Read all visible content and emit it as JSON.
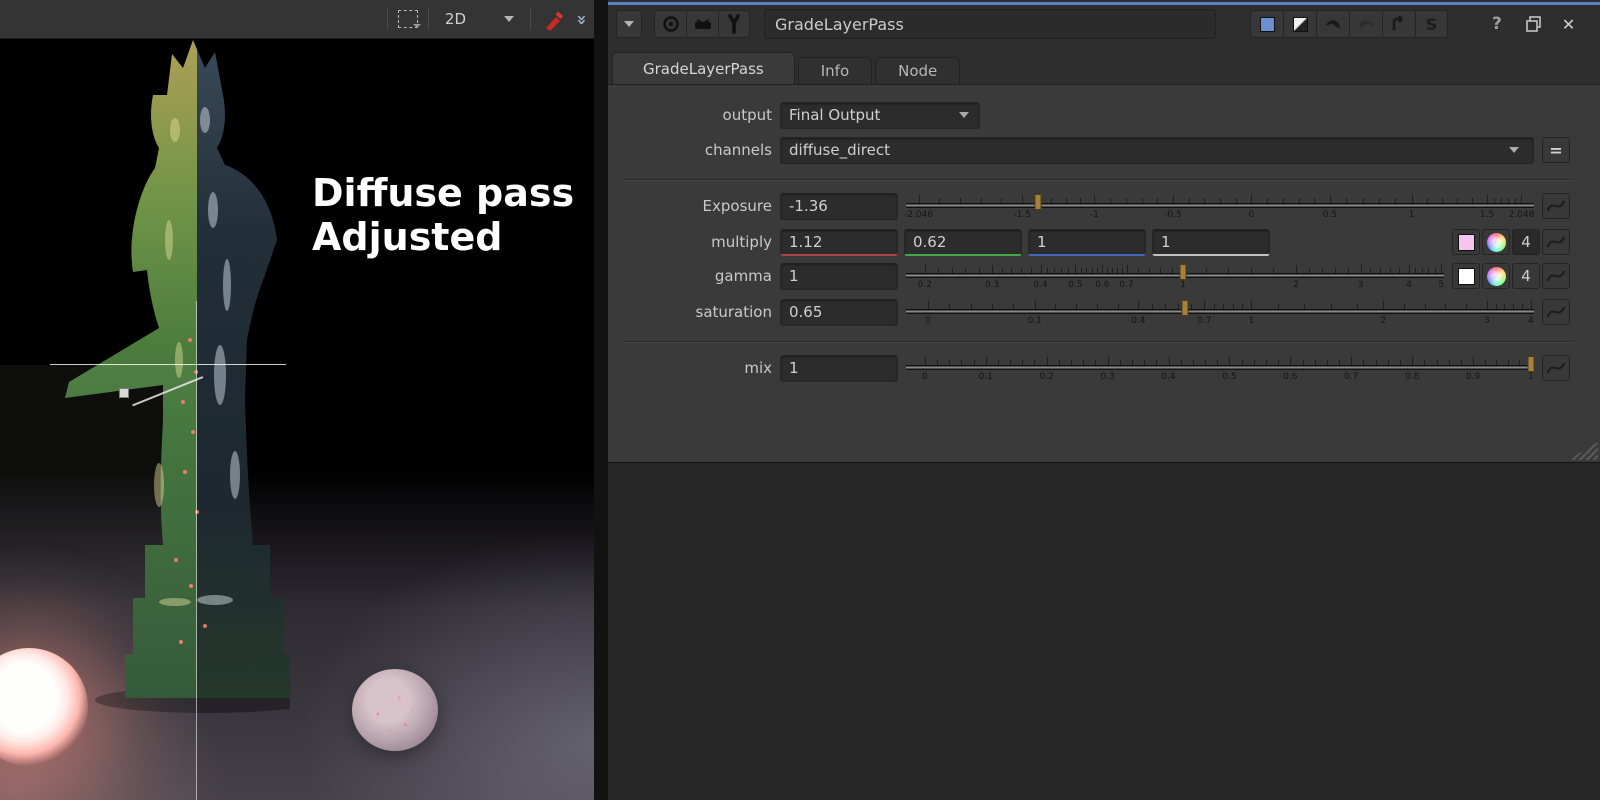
{
  "viewer": {
    "toolbar": {
      "view_mode": "2D"
    },
    "overlay": {
      "line1": "Diffuse pass",
      "line2": "Adjusted"
    }
  },
  "panel": {
    "header": {
      "node_name": "GradeLayerPass",
      "s_label": "S",
      "help_label": "?",
      "close_label": "✕"
    },
    "tabs": [
      {
        "label": "GradeLayerPass",
        "active": true
      },
      {
        "label": "Info",
        "active": false
      },
      {
        "label": "Node",
        "active": false
      }
    ],
    "rows": {
      "output": {
        "label": "output",
        "value": "Final Output"
      },
      "channels": {
        "label": "channels",
        "value": "diffuse_direct",
        "equals_label": "="
      },
      "exposure": {
        "label": "Exposure",
        "value": "-1.36",
        "slider": {
          "handle_p": 21,
          "labels": [
            {
              "t": "-2.046",
              "p": 2
            },
            {
              "t": "-1.5",
              "p": 18.5
            },
            {
              "t": "-1",
              "p": 30
            },
            {
              "t": "-0.5",
              "p": 42.5
            },
            {
              "t": "0",
              "p": 55
            },
            {
              "t": "0.5",
              "p": 67.5
            },
            {
              "t": "1",
              "p": 80.5
            },
            {
              "t": "1.5",
              "p": 92.5
            },
            {
              "t": "2.048",
              "p": 98
            }
          ]
        }
      },
      "multiply": {
        "label": "multiply",
        "values": [
          "1.12",
          "0.62",
          "1",
          "1"
        ],
        "count_label": "4",
        "swatch_color": "#f6c4f0"
      },
      "gamma": {
        "label": "gamma",
        "value": "1",
        "count_label": "4",
        "swatch_color": "#ffffff",
        "slider": {
          "handle_p": 51.5,
          "labels": [
            {
              "t": "0.2",
              "p": 3.5
            },
            {
              "t": "0.3",
              "p": 16
            },
            {
              "t": "0.4",
              "p": 25
            },
            {
              "t": "0.5",
              "p": 31.5
            },
            {
              "t": "0.6",
              "p": 36.5
            },
            {
              "t": "0.7",
              "p": 41
            },
            {
              "t": "1",
              "p": 51.5
            },
            {
              "t": "2",
              "p": 72.5
            },
            {
              "t": "3",
              "p": 84.5
            },
            {
              "t": "4",
              "p": 93.5
            },
            {
              "t": "5",
              "p": 99.5
            }
          ]
        }
      },
      "saturation": {
        "label": "saturation",
        "value": "0.65",
        "slider": {
          "handle_p": 44.5,
          "labels": [
            {
              "t": "0",
              "p": 3.5
            },
            {
              "t": "0.1",
              "p": 20.5
            },
            {
              "t": "0.4",
              "p": 37
            },
            {
              "t": "0.7",
              "p": 47.5
            },
            {
              "t": "1",
              "p": 55
            },
            {
              "t": "2",
              "p": 76
            },
            {
              "t": "3",
              "p": 92.5
            },
            {
              "t": "4",
              "p": 99.5
            }
          ]
        }
      },
      "mix": {
        "label": "mix",
        "value": "1",
        "slider": {
          "handle_p": 99.5,
          "labels": [
            {
              "t": "0",
              "p": 3
            },
            {
              "t": "0.1",
              "p": 12.7
            },
            {
              "t": "0.2",
              "p": 22.4
            },
            {
              "t": "0.3",
              "p": 32.1
            },
            {
              "t": "0.4",
              "p": 41.8
            },
            {
              "t": "0.5",
              "p": 51.5
            },
            {
              "t": "0.6",
              "p": 61.2
            },
            {
              "t": "0.7",
              "p": 70.9
            },
            {
              "t": "0.8",
              "p": 80.6
            },
            {
              "t": "0.9",
              "p": 90.3
            },
            {
              "t": "1",
              "p": 99.5
            }
          ]
        }
      }
    }
  },
  "colors": {
    "focus_blue": "#5a82c4",
    "slider_handle": "#a5823c",
    "channel_red": "#b04343",
    "channel_green": "#44a944",
    "channel_blue": "#4468c0",
    "channel_alpha": "#c2c2c2"
  }
}
